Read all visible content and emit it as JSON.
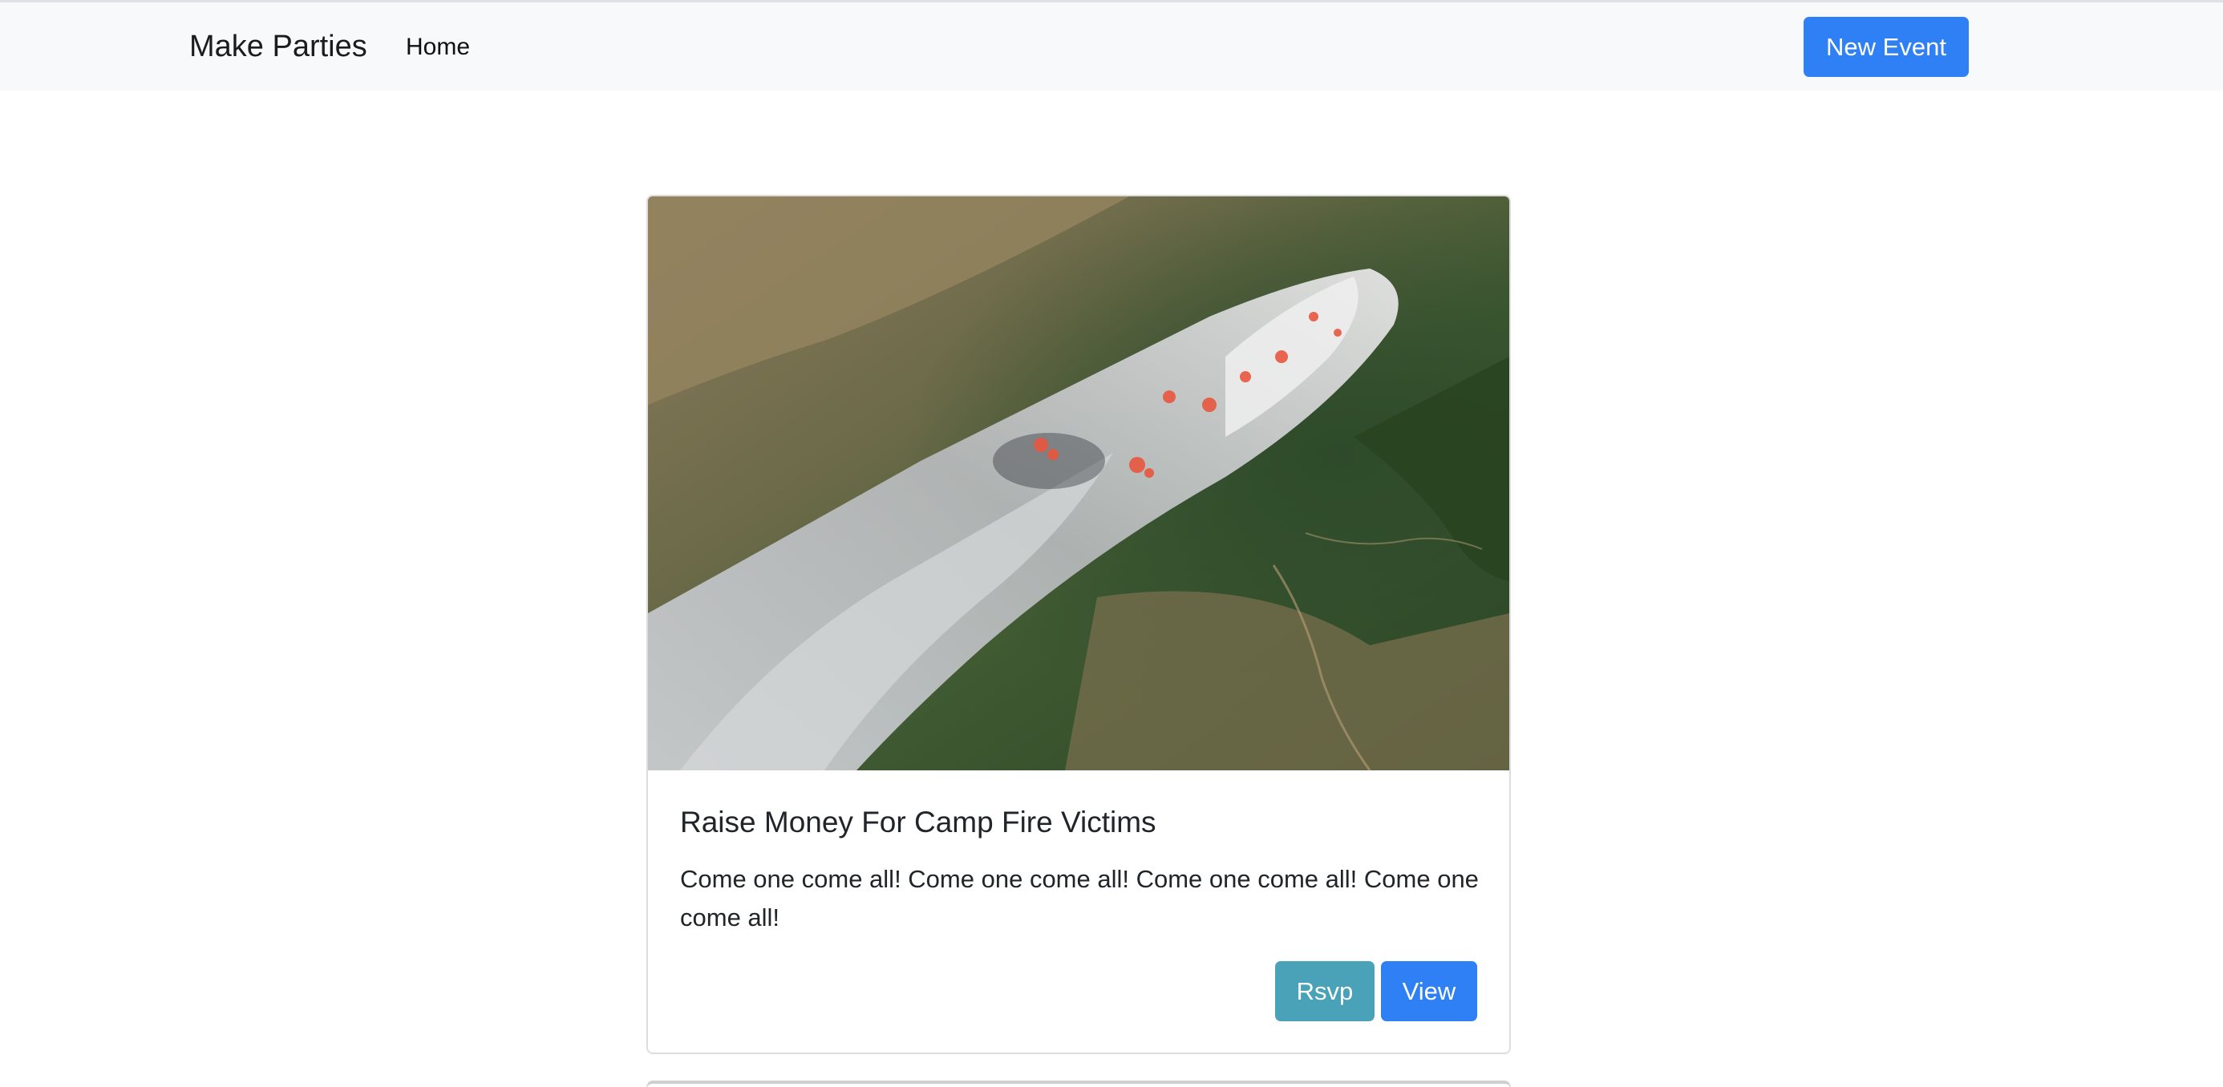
{
  "navbar": {
    "brand": "Make Parties",
    "home_link": "Home",
    "new_event_button": "New Event"
  },
  "event_card": {
    "image_subject": "satellite-view-of-wildfire-smoke-plume",
    "title": "Raise Money For Camp Fire Victims",
    "description": "Come one come all! Come one come all! Come one come all! Come one come all!",
    "rsvp_button": "Rsvp",
    "view_button": "View"
  },
  "colors": {
    "navbar_background": "#f8f9fa",
    "primary_button": "#2f80f5",
    "info_button": "#49a2b7"
  }
}
